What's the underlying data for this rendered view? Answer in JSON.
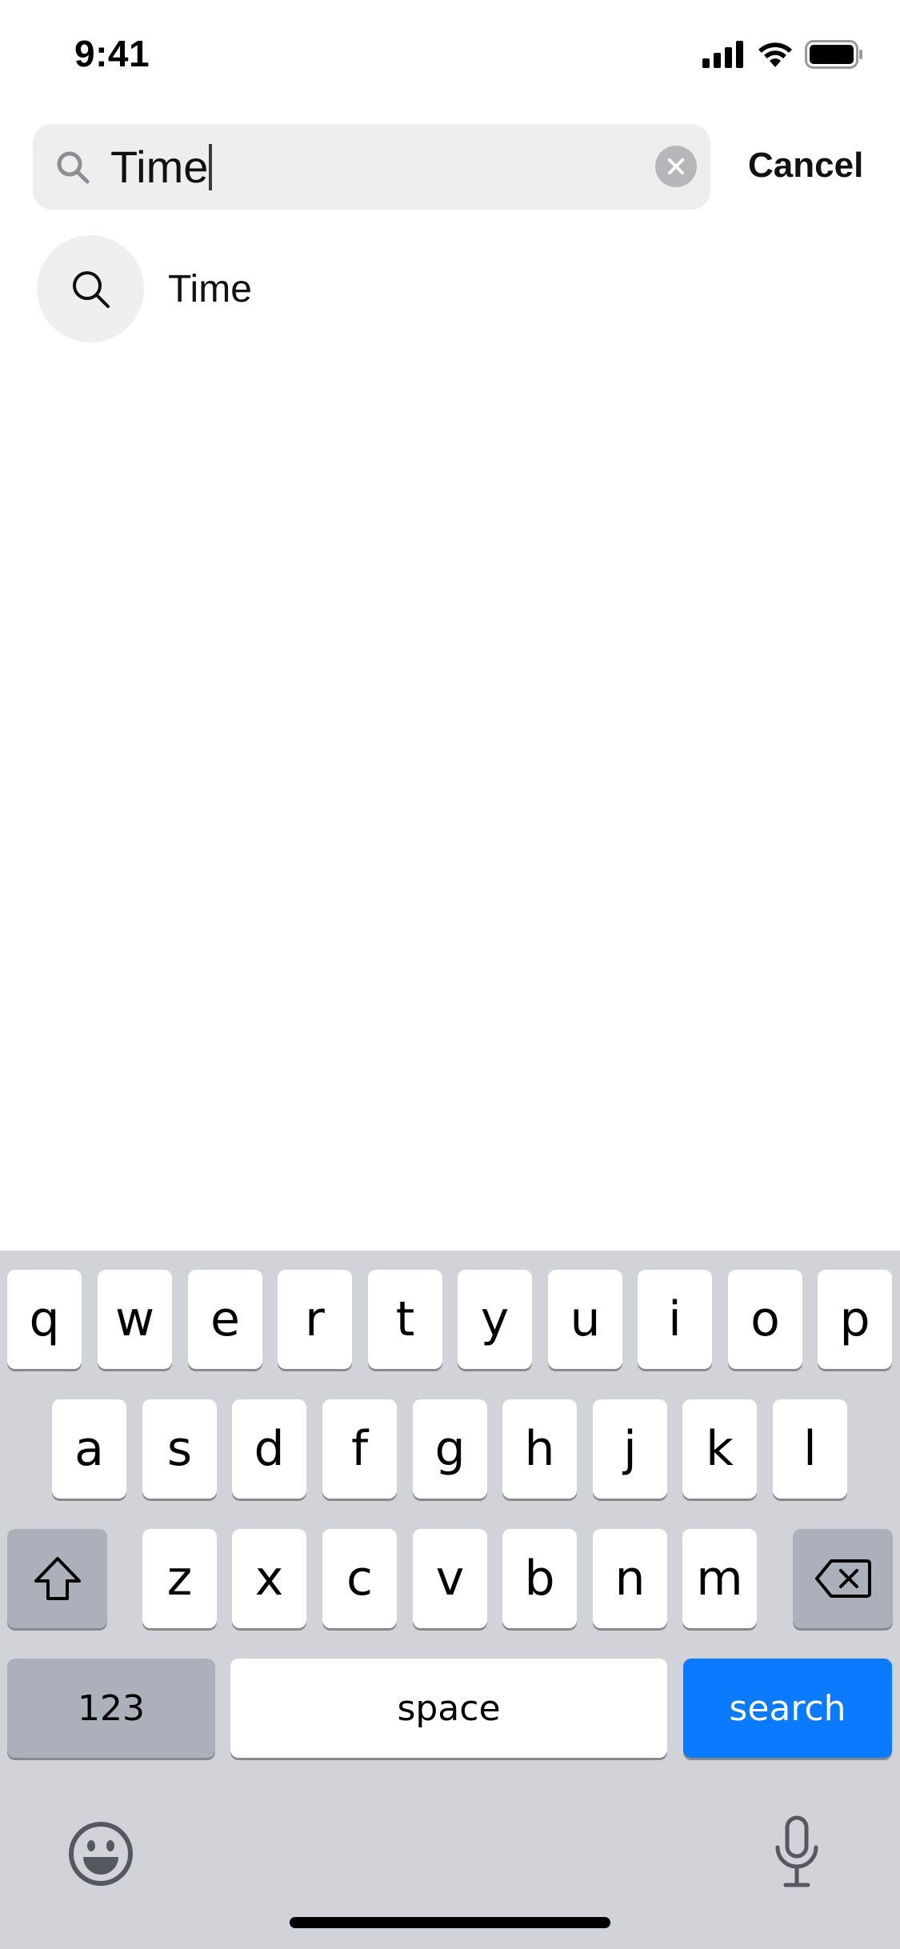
{
  "status_bar": {
    "time": "9:41"
  },
  "search": {
    "value": "Time",
    "cancel_label": "Cancel"
  },
  "suggestions": [
    {
      "label": "Time"
    }
  ],
  "keyboard": {
    "row1": [
      "q",
      "w",
      "e",
      "r",
      "t",
      "y",
      "u",
      "i",
      "o",
      "p"
    ],
    "row2": [
      "a",
      "s",
      "d",
      "f",
      "g",
      "h",
      "j",
      "k",
      "l"
    ],
    "row3": [
      "z",
      "x",
      "c",
      "v",
      "b",
      "n",
      "m"
    ],
    "numbers_label": "123",
    "space_label": "space",
    "search_label": "search"
  },
  "colors": {
    "accent": "#0a7aff",
    "keyboard_bg": "#d1d3d9",
    "search_field_bg": "#eeeeef"
  }
}
